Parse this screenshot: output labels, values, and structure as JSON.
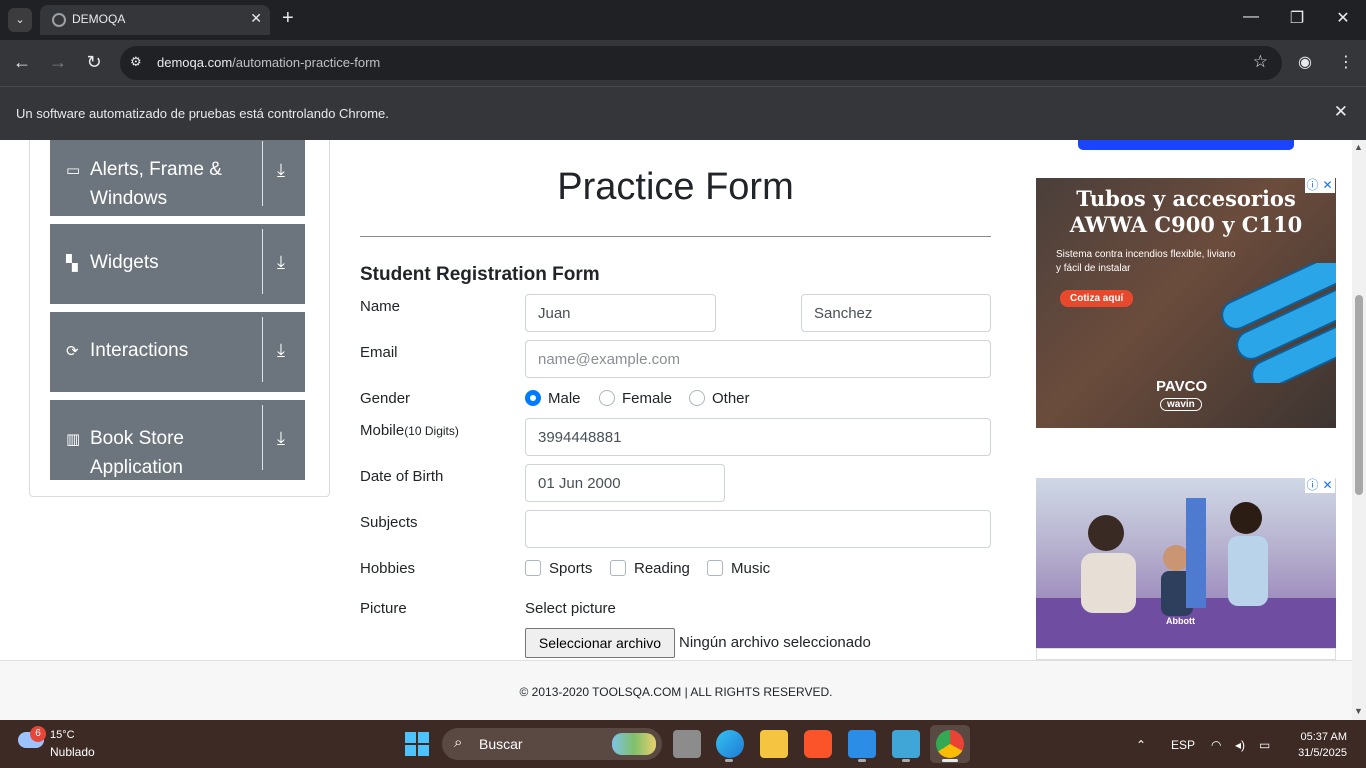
{
  "browser": {
    "tab_title": "DEMOQA",
    "tab_menu_icon": "chevron-down-icon",
    "new_tab_icon": "plus-icon",
    "url_host": "demoqa.com",
    "url_path": "/automation-practice-form",
    "infobar_message": "Un software automatizado de pruebas está controlando Chrome."
  },
  "sidebar": {
    "groups": [
      {
        "label": "Alerts, Frame & Windows",
        "icon": "window-icon"
      },
      {
        "label": "Widgets",
        "icon": "widgets-icon"
      },
      {
        "label": "Interactions",
        "icon": "interactions-icon"
      },
      {
        "label": "Book Store Application",
        "icon": "books-icon"
      }
    ]
  },
  "form": {
    "page_title": "Practice Form",
    "subtitle": "Student Registration Form",
    "labels": {
      "name": "Name",
      "email": "Email",
      "gender": "Gender",
      "mobile": "Mobile",
      "mobile_hint": "(10 Digits)",
      "dob": "Date of Birth",
      "subjects": "Subjects",
      "hobbies": "Hobbies",
      "picture": "Picture"
    },
    "first_name": "Juan",
    "last_name": "Sanchez",
    "email_placeholder": "name@example.com",
    "gender_options": [
      "Male",
      "Female",
      "Other"
    ],
    "gender_selected": "Male",
    "mobile": "3994448881",
    "dob": "01 Jun 2000",
    "subjects": "",
    "hobby_options": [
      "Sports",
      "Reading",
      "Music"
    ],
    "picture_label": "Select picture",
    "file_button": "Seleccionar archivo",
    "file_status": "Ningún archivo seleccionado"
  },
  "ads": {
    "ad1_headline": "Tubos y accesorios AWWA C900 y C110",
    "ad1_sub": "Sistema contra incendios flexible, liviano y fácil de instalar",
    "ad1_cta": "Cotiza aquí",
    "ad1_brand": "PAVCO",
    "ad1_brand2": "wavin",
    "ad2_brand": "Abbott"
  },
  "footer": {
    "text": "© 2013-2020 TOOLSQA.COM | ALL RIGHTS RESERVED."
  },
  "taskbar": {
    "weather_badge": "6",
    "temperature": "15°C",
    "condition": "Nublado",
    "search_placeholder": "Buscar",
    "language": "ESP",
    "time": "05:37 AM",
    "date": "31/5/2025"
  },
  "colors": {
    "sidebar_group": "#6c757d",
    "radio_checked": "#007bff",
    "chrome_dark": "#202124",
    "taskbar": "#3d2a25"
  }
}
